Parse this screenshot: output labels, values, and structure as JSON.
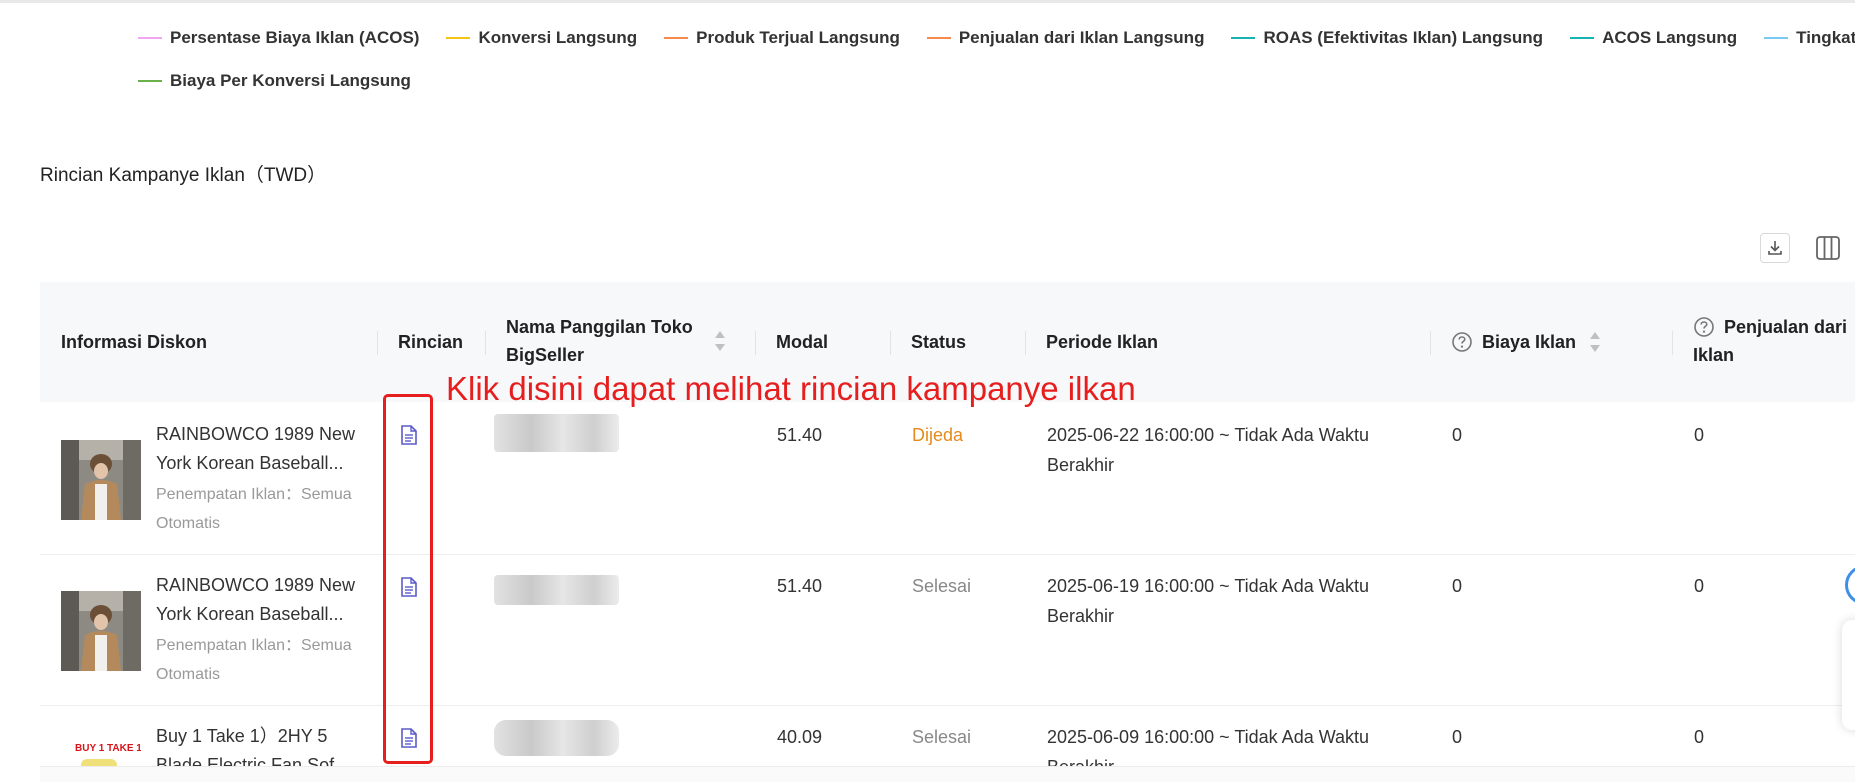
{
  "legend": {
    "row1": [
      {
        "label": "Persentase Biaya Iklan (ACOS)",
        "color": "#f0a6f0"
      },
      {
        "label": "Konversi Langsung",
        "color": "#f5c518"
      },
      {
        "label": "Produk Terjual Langsung",
        "color": "#f58a4b"
      },
      {
        "label": "Penjualan dari Iklan Langsung",
        "color": "#f58a4b"
      },
      {
        "label": "ROAS (Efektivitas Iklan) Langsung",
        "color": "#17b3b3"
      },
      {
        "label": "ACOS Langsung",
        "color": "#17b3b3"
      },
      {
        "label": "Tingkat Ko",
        "color": "#7cc8f5"
      }
    ],
    "row2": [
      {
        "label": "Biaya Per Konversi Langsung",
        "color": "#6ab04c"
      }
    ]
  },
  "section": {
    "title": "Rincian Kampanye Iklan（TWD）"
  },
  "toolbar": {
    "download_icon": "download-icon",
    "columns_icon": "columns-icon"
  },
  "table": {
    "headers": {
      "info": "Informasi Diskon",
      "detail": "Rincian",
      "shop_line1": "Nama Panggilan Toko",
      "shop_line2": "BigSeller",
      "budget": "Modal",
      "status": "Status",
      "period": "Periode Iklan",
      "cost": "Biaya Iklan",
      "sales_line1": "Penjualan dari",
      "sales_line2": "Iklan"
    },
    "rows": [
      {
        "title_line1": "RAINBOWCO 1989 New",
        "title_line2": "York Korean Baseball...",
        "placement_line1": "Penempatan Iklan：Semua",
        "placement_line2": "Otomatis",
        "budget": "51.40",
        "status": "Dijeda",
        "status_color": "#e8891b",
        "period_line1": "2025-06-22 16:00:00 ~ Tidak Ada Waktu",
        "period_line2": "Berakhir",
        "cost": "0",
        "sales": "0"
      },
      {
        "title_line1": "RAINBOWCO 1989 New",
        "title_line2": "York Korean Baseball...",
        "placement_line1": "Penempatan Iklan：Semua",
        "placement_line2": "Otomatis",
        "budget": "51.40",
        "status": "Selesai",
        "status_color": "#888888",
        "period_line1": "2025-06-19 16:00:00 ~ Tidak Ada Waktu",
        "period_line2": "Berakhir",
        "cost": "0",
        "sales": "0"
      },
      {
        "title_line1": "Buy 1 Take 1）2HY 5",
        "title_line2": "Blade Electric Fan Sof",
        "thumb_text": "BUY 1 TAKE 1",
        "budget": "40.09",
        "status": "Selesai",
        "status_color": "#888888",
        "period_line1": "2025-06-09 16:00:00 ~ Tidak Ada Waktu",
        "period_line2": "Berakhir",
        "cost": "0",
        "sales": "0"
      }
    ]
  },
  "annotation": {
    "text": "Klik disini dapat melihat rincian kampanye ilkan",
    "color": "#e61e1e"
  }
}
